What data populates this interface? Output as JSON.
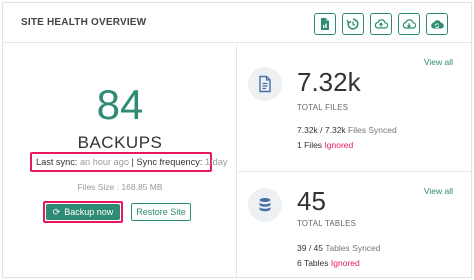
{
  "header": {
    "title": "SITE HEALTH OVERVIEW",
    "buttons": [
      {
        "icon": "file-report-icon"
      },
      {
        "icon": "restore-icon"
      },
      {
        "icon": "cloud-upload-icon"
      },
      {
        "icon": "cloud-download-icon"
      },
      {
        "icon": "cloud-sync-icon"
      }
    ]
  },
  "backups": {
    "count": "84",
    "label": "BACKUPS",
    "last_sync_label": "Last sync:",
    "last_sync_value": "an hour ago",
    "separator": "|",
    "sync_frequency_label": "Sync frequency:",
    "sync_frequency_value": "1/day",
    "files_size": "Files Size : 168.85 MB",
    "backup_now_label": "Backup now",
    "restore_label": "Restore Site"
  },
  "files": {
    "view_all": "View all",
    "count": "7.32k",
    "label": "TOTAL FILES",
    "synced_ratio": "7.32k / 7.32k",
    "synced_text": "Files Synced",
    "ignored_count": "1",
    "ignored_files_text": "Files",
    "ignored_text": "Ignored"
  },
  "tables": {
    "view_all": "View all",
    "count": "45",
    "label": "TOTAL TABLES",
    "synced_ratio": "39 / 45",
    "synced_text": "Tables Synced",
    "ignored_count": "6",
    "ignored_tables_text": "Tables",
    "ignored_text": "Ignored"
  },
  "colors": {
    "accent": "#2e8b74",
    "highlight": "#e6185f",
    "muted": "#9a9a9a",
    "icon_blue": "#4a6fa5"
  }
}
